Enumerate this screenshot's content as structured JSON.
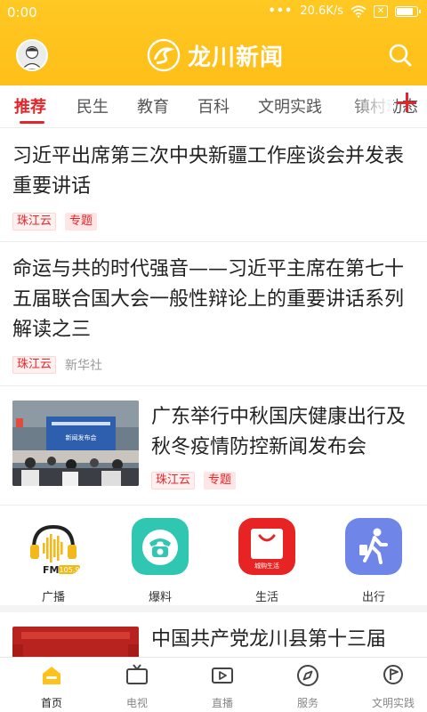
{
  "status_bar": {
    "time": "0:00",
    "network_speed": "20.6K/s",
    "dots": "•••",
    "sim_label": "✕",
    "battery_level": 0.85
  },
  "header": {
    "app_name": "龙川新闻",
    "brand_color": "#ffc21c"
  },
  "tabs": {
    "items": [
      {
        "label": "推荐"
      },
      {
        "label": "民生"
      },
      {
        "label": "教育"
      },
      {
        "label": "百科"
      },
      {
        "label": "文明实践"
      },
      {
        "label": "镇村动态"
      }
    ],
    "active_index": 0,
    "accent_color": "#e3262a"
  },
  "news": [
    {
      "title": "习近平出席第三次中央新疆工作座谈会并发表重要讲话",
      "source": "珠江云",
      "tag": "专题"
    },
    {
      "title": "命运与共的时代强音——习近平主席在第七十五届联合国大会一般性辩论上的重要讲话系列解读之三",
      "source": "珠江云",
      "source2": "新华社"
    },
    {
      "title": "广东举行中秋国庆健康出行及秋冬疫情防控新闻发布会",
      "source": "珠江云",
      "tag": "专题",
      "thumb_caption": "新闻发布会"
    },
    {
      "title": "中国共产党龙川县第十三届"
    }
  ],
  "services": [
    {
      "label": "广播",
      "icon": "fm-radio-icon",
      "fm_text": "FM",
      "fm_freq": "105.9"
    },
    {
      "label": "爆料",
      "icon": "telephone-icon"
    },
    {
      "label": "生活",
      "icon": "shopping-bag-icon",
      "icon_text": "城购生活"
    },
    {
      "label": "出行",
      "icon": "walking-person-icon"
    }
  ],
  "bottom_nav": {
    "items": [
      {
        "label": "首页",
        "icon": "home-icon"
      },
      {
        "label": "电视",
        "icon": "tv-icon"
      },
      {
        "label": "直播",
        "icon": "live-video-icon"
      },
      {
        "label": "服务",
        "icon": "compass-icon"
      },
      {
        "label": "文明实践",
        "icon": "flag-pin-icon"
      }
    ],
    "active_index": 0
  }
}
